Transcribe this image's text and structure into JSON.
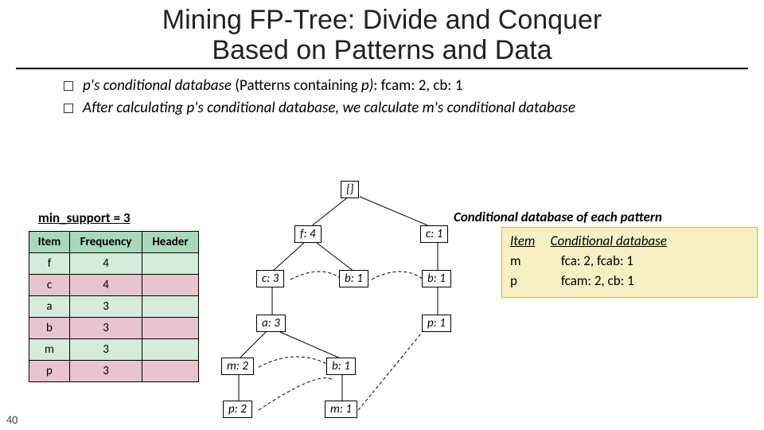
{
  "title_l1": "Mining FP-Tree: Divide and Conquer",
  "title_l2": "Based on Patterns and Data",
  "bullets": {
    "b1_pre": "p's conditional database ",
    "b1_mid": "(Patterns containing ",
    "b1_p": "p)",
    "b1_post": ":  fcam: 2, cb: 1",
    "b2": "After calculating p's conditional database, we calculate m's conditional database"
  },
  "min_support": "min_support = 3",
  "header_table": {
    "cols": [
      "Item",
      "Frequency",
      "Header"
    ],
    "rows": [
      {
        "item": "f",
        "freq": "4"
      },
      {
        "item": "c",
        "freq": "4"
      },
      {
        "item": "a",
        "freq": "3"
      },
      {
        "item": "b",
        "freq": "3"
      },
      {
        "item": "m",
        "freq": "3"
      },
      {
        "item": "p",
        "freq": "3"
      }
    ]
  },
  "tree": {
    "root": "{}",
    "f4": "f: 4",
    "c1": "c: 1",
    "c3": "c: 3",
    "b1a": "b: 1",
    "b1b": "b: 1",
    "a3": "a: 3",
    "p1": "p: 1",
    "m2": "m: 2",
    "b1c": "b: 1",
    "p2": "p: 2",
    "m1": "m: 1"
  },
  "cond_title": "Conditional database of each pattern",
  "cond": {
    "h_item": "Item",
    "h_db": "Conditional database",
    "r1_item": "m",
    "r1_db": "fca: 2, fcab: 1",
    "r2_item": "p",
    "r2_db": "fcam: 2, cb: 1"
  },
  "page": "40"
}
